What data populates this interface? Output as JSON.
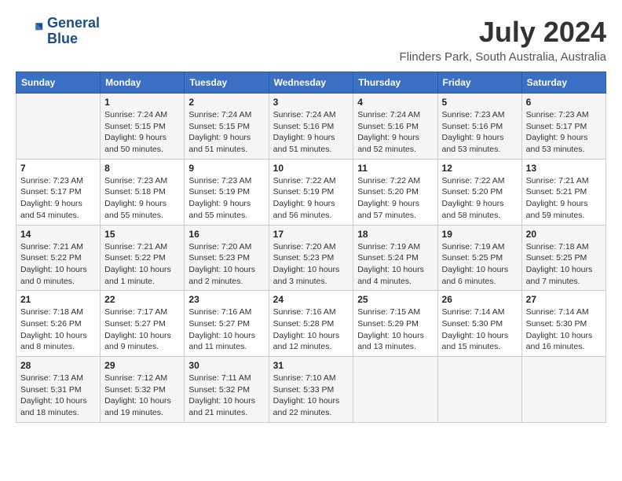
{
  "logo": {
    "name": "GeneralBlue",
    "line1": "General",
    "line2": "Blue"
  },
  "title": "July 2024",
  "location": "Flinders Park, South Australia, Australia",
  "days_of_week": [
    "Sunday",
    "Monday",
    "Tuesday",
    "Wednesday",
    "Thursday",
    "Friday",
    "Saturday"
  ],
  "weeks": [
    [
      {
        "day": "",
        "info": ""
      },
      {
        "day": "1",
        "info": "Sunrise: 7:24 AM\nSunset: 5:15 PM\nDaylight: 9 hours\nand 50 minutes."
      },
      {
        "day": "2",
        "info": "Sunrise: 7:24 AM\nSunset: 5:15 PM\nDaylight: 9 hours\nand 51 minutes."
      },
      {
        "day": "3",
        "info": "Sunrise: 7:24 AM\nSunset: 5:16 PM\nDaylight: 9 hours\nand 51 minutes."
      },
      {
        "day": "4",
        "info": "Sunrise: 7:24 AM\nSunset: 5:16 PM\nDaylight: 9 hours\nand 52 minutes."
      },
      {
        "day": "5",
        "info": "Sunrise: 7:23 AM\nSunset: 5:16 PM\nDaylight: 9 hours\nand 53 minutes."
      },
      {
        "day": "6",
        "info": "Sunrise: 7:23 AM\nSunset: 5:17 PM\nDaylight: 9 hours\nand 53 minutes."
      }
    ],
    [
      {
        "day": "7",
        "info": "Sunrise: 7:23 AM\nSunset: 5:17 PM\nDaylight: 9 hours\nand 54 minutes."
      },
      {
        "day": "8",
        "info": "Sunrise: 7:23 AM\nSunset: 5:18 PM\nDaylight: 9 hours\nand 55 minutes."
      },
      {
        "day": "9",
        "info": "Sunrise: 7:23 AM\nSunset: 5:19 PM\nDaylight: 9 hours\nand 55 minutes."
      },
      {
        "day": "10",
        "info": "Sunrise: 7:22 AM\nSunset: 5:19 PM\nDaylight: 9 hours\nand 56 minutes."
      },
      {
        "day": "11",
        "info": "Sunrise: 7:22 AM\nSunset: 5:20 PM\nDaylight: 9 hours\nand 57 minutes."
      },
      {
        "day": "12",
        "info": "Sunrise: 7:22 AM\nSunset: 5:20 PM\nDaylight: 9 hours\nand 58 minutes."
      },
      {
        "day": "13",
        "info": "Sunrise: 7:21 AM\nSunset: 5:21 PM\nDaylight: 9 hours\nand 59 minutes."
      }
    ],
    [
      {
        "day": "14",
        "info": "Sunrise: 7:21 AM\nSunset: 5:22 PM\nDaylight: 10 hours\nand 0 minutes."
      },
      {
        "day": "15",
        "info": "Sunrise: 7:21 AM\nSunset: 5:22 PM\nDaylight: 10 hours\nand 1 minute."
      },
      {
        "day": "16",
        "info": "Sunrise: 7:20 AM\nSunset: 5:23 PM\nDaylight: 10 hours\nand 2 minutes."
      },
      {
        "day": "17",
        "info": "Sunrise: 7:20 AM\nSunset: 5:23 PM\nDaylight: 10 hours\nand 3 minutes."
      },
      {
        "day": "18",
        "info": "Sunrise: 7:19 AM\nSunset: 5:24 PM\nDaylight: 10 hours\nand 4 minutes."
      },
      {
        "day": "19",
        "info": "Sunrise: 7:19 AM\nSunset: 5:25 PM\nDaylight: 10 hours\nand 6 minutes."
      },
      {
        "day": "20",
        "info": "Sunrise: 7:18 AM\nSunset: 5:25 PM\nDaylight: 10 hours\nand 7 minutes."
      }
    ],
    [
      {
        "day": "21",
        "info": "Sunrise: 7:18 AM\nSunset: 5:26 PM\nDaylight: 10 hours\nand 8 minutes."
      },
      {
        "day": "22",
        "info": "Sunrise: 7:17 AM\nSunset: 5:27 PM\nDaylight: 10 hours\nand 9 minutes."
      },
      {
        "day": "23",
        "info": "Sunrise: 7:16 AM\nSunset: 5:27 PM\nDaylight: 10 hours\nand 11 minutes."
      },
      {
        "day": "24",
        "info": "Sunrise: 7:16 AM\nSunset: 5:28 PM\nDaylight: 10 hours\nand 12 minutes."
      },
      {
        "day": "25",
        "info": "Sunrise: 7:15 AM\nSunset: 5:29 PM\nDaylight: 10 hours\nand 13 minutes."
      },
      {
        "day": "26",
        "info": "Sunrise: 7:14 AM\nSunset: 5:30 PM\nDaylight: 10 hours\nand 15 minutes."
      },
      {
        "day": "27",
        "info": "Sunrise: 7:14 AM\nSunset: 5:30 PM\nDaylight: 10 hours\nand 16 minutes."
      }
    ],
    [
      {
        "day": "28",
        "info": "Sunrise: 7:13 AM\nSunset: 5:31 PM\nDaylight: 10 hours\nand 18 minutes."
      },
      {
        "day": "29",
        "info": "Sunrise: 7:12 AM\nSunset: 5:32 PM\nDaylight: 10 hours\nand 19 minutes."
      },
      {
        "day": "30",
        "info": "Sunrise: 7:11 AM\nSunset: 5:32 PM\nDaylight: 10 hours\nand 21 minutes."
      },
      {
        "day": "31",
        "info": "Sunrise: 7:10 AM\nSunset: 5:33 PM\nDaylight: 10 hours\nand 22 minutes."
      },
      {
        "day": "",
        "info": ""
      },
      {
        "day": "",
        "info": ""
      },
      {
        "day": "",
        "info": ""
      }
    ]
  ]
}
